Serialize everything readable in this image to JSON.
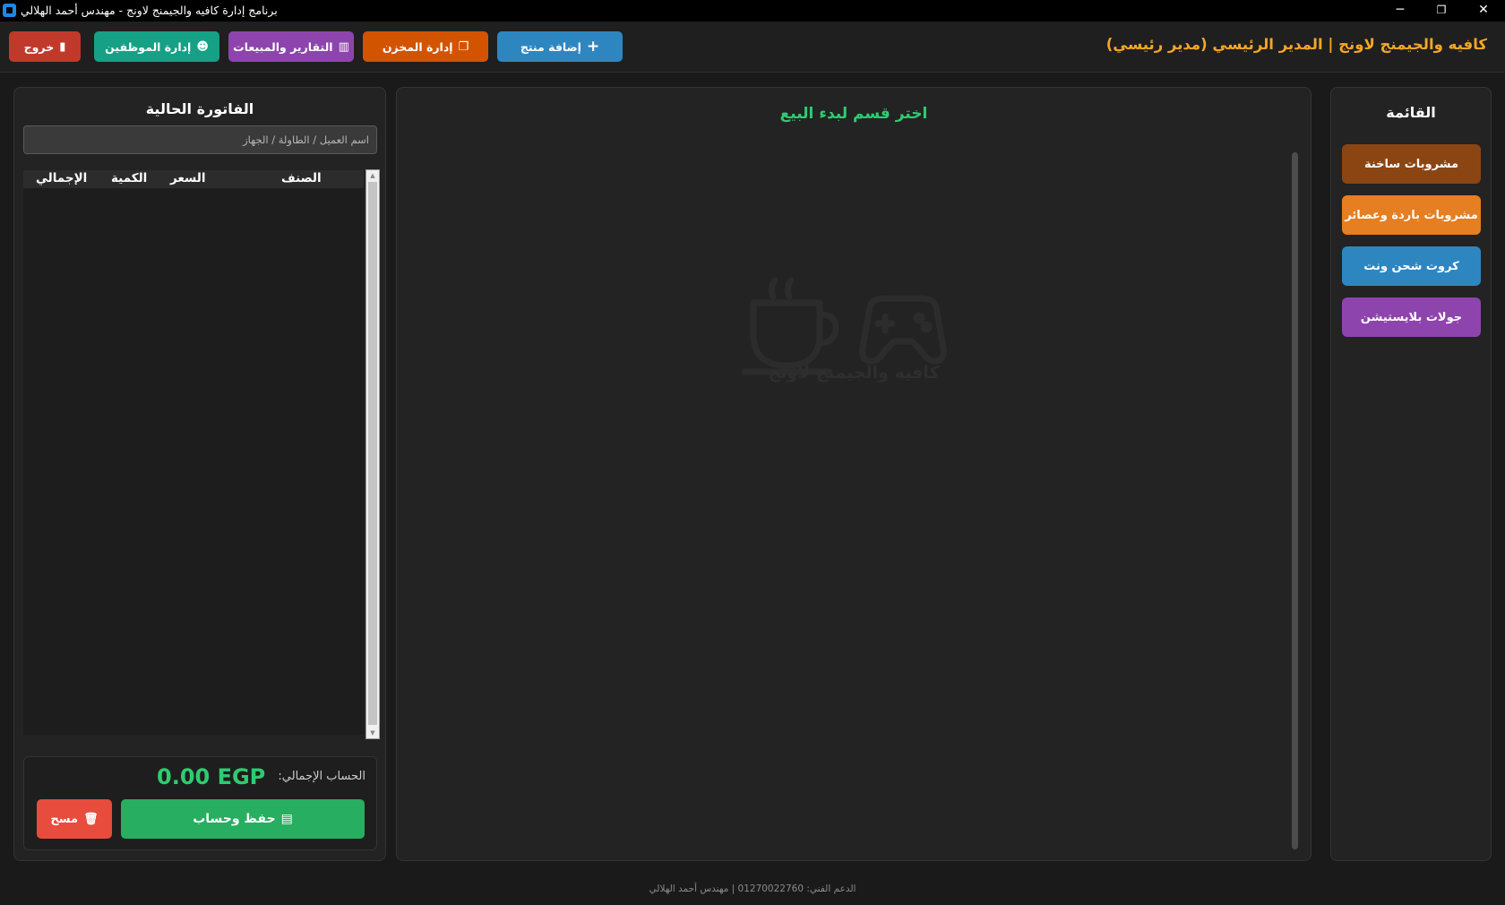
{
  "window": {
    "title": "برنامج إدارة كافيه والجيمنج لاونج - مهندس أحمد الهلالي",
    "minimize": "─",
    "restore": "❐",
    "close": "✕"
  },
  "header": {
    "title": "كافيه والجيمنج لاونج | المدير الرئيسي (مدير رئيسي)",
    "buttons": {
      "add_product": {
        "label": "إضافة منتج",
        "icon": "+",
        "color": "#2e86c1"
      },
      "inventory": {
        "label": "إدارة المخزن",
        "icon": "❐",
        "color": "#d35400"
      },
      "reports": {
        "label": "التقارير والمبيعات",
        "icon": "▥",
        "color": "#8e44ad"
      },
      "employees": {
        "label": "إدارة الموظفين",
        "icon": "☻",
        "color": "#16a085"
      },
      "logout": {
        "label": "خروج",
        "icon": "▮",
        "color": "#c0392b"
      }
    }
  },
  "menu": {
    "title": "القائمة",
    "categories": [
      {
        "label": "مشروبات ساخنة",
        "color": "#8b4513"
      },
      {
        "label": "مشروبات باردة وعصائر",
        "color": "#e67e22"
      },
      {
        "label": "كروت شحن ونت",
        "color": "#2e86c1"
      },
      {
        "label": "جولات بلايستيشن",
        "color": "#8e44ad"
      }
    ]
  },
  "main": {
    "prompt": "اختر قسم لبدء البيع",
    "watermark": "كافيه والجيمنج لاونج",
    "accent": "#2ecc71"
  },
  "invoice": {
    "title": "الفاتورة الحالية",
    "customer_placeholder": "اسم العميل / الطاولة / الجهاز",
    "columns": [
      "الصنف",
      "السعر",
      "الكمية",
      "الإجمالي"
    ],
    "rows": [],
    "total_label": "الحساب الإجمالي:",
    "total_value": "0.00 EGP",
    "save_label": "حفظ وحساب",
    "save_icon": "▤",
    "clear_label": "مسح",
    "clear_icon": "🗑"
  },
  "footer": {
    "text": "الدعم الفني: 01270022760 | مهندس أحمد الهلالي"
  }
}
